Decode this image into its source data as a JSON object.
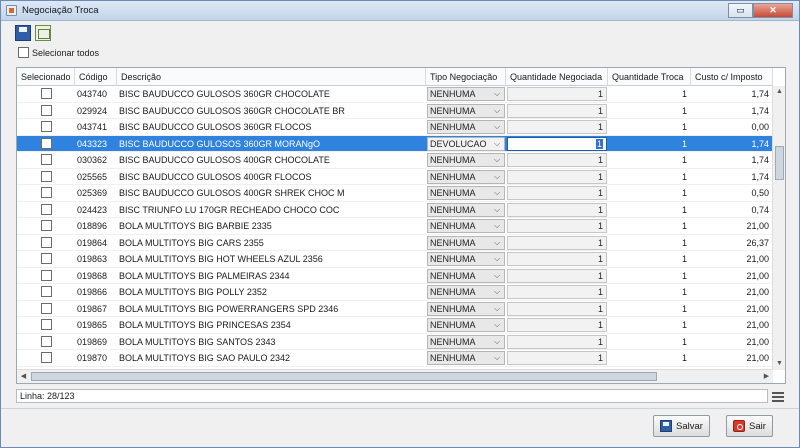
{
  "window": {
    "title": "Negociação Troca"
  },
  "window_buttons": {
    "restore": "▭",
    "close": "✕"
  },
  "select_all": {
    "label": "Selecionar todos"
  },
  "table": {
    "columns": [
      "Selecionado",
      "Código",
      "Descrição",
      "Tipo Negociação",
      "Quantidade Negociada",
      "Quantidade Troca",
      "Custo c/ Imposto"
    ],
    "rows": [
      {
        "code": "043740",
        "desc": "BISC BAUDUCCO GULOSOS 360GR CHOCOLATE",
        "tipo": "NENHUMA",
        "qtd_neg": "1",
        "qtd_troca": "1",
        "custo": "1,74"
      },
      {
        "code": "029924",
        "desc": "BISC BAUDUCCO GULOSOS 360GR CHOCOLATE BR",
        "tipo": "NENHUMA",
        "qtd_neg": "1",
        "qtd_troca": "1",
        "custo": "1,74"
      },
      {
        "code": "043741",
        "desc": "BISC BAUDUCCO GULOSOS 360GR FLOCOS",
        "tipo": "NENHUMA",
        "qtd_neg": "1",
        "qtd_troca": "1",
        "custo": "0,00"
      },
      {
        "code": "043323",
        "desc": "BISC BAUDUCCO GULOSOS 360GR MORANgO",
        "tipo": "DEVOLUCAO",
        "qtd_neg": "1",
        "qtd_troca": "1",
        "custo": "1,74",
        "selected": true
      },
      {
        "code": "030362",
        "desc": "BISC BAUDUCCO GULOSOS 400GR CHOCOLATE",
        "tipo": "NENHUMA",
        "qtd_neg": "1",
        "qtd_troca": "1",
        "custo": "1,74"
      },
      {
        "code": "025565",
        "desc": "BISC BAUDUCCO GULOSOS 400GR FLOCOS",
        "tipo": "NENHUMA",
        "qtd_neg": "1",
        "qtd_troca": "1",
        "custo": "1,74"
      },
      {
        "code": "025369",
        "desc": "BISC BAUDUCCO GULOSOS 400GR SHREK CHOC M",
        "tipo": "NENHUMA",
        "qtd_neg": "1",
        "qtd_troca": "1",
        "custo": "0,50"
      },
      {
        "code": "024423",
        "desc": "BISC TRIUNFO LU 170GR RECHEADO CHOCO COC",
        "tipo": "NENHUMA",
        "qtd_neg": "1",
        "qtd_troca": "1",
        "custo": "0,74"
      },
      {
        "code": "018896",
        "desc": "BOLA MULTITOYS BIG BARBIE 2335",
        "tipo": "NENHUMA",
        "qtd_neg": "1",
        "qtd_troca": "1",
        "custo": "21,00"
      },
      {
        "code": "019864",
        "desc": "BOLA MULTITOYS BIG CARS 2355",
        "tipo": "NENHUMA",
        "qtd_neg": "1",
        "qtd_troca": "1",
        "custo": "26,37"
      },
      {
        "code": "019863",
        "desc": "BOLA MULTITOYS BIG HOT WHEELS AZUL 2356",
        "tipo": "NENHUMA",
        "qtd_neg": "1",
        "qtd_troca": "1",
        "custo": "21,00"
      },
      {
        "code": "019868",
        "desc": "BOLA MULTITOYS BIG PALMEIRAS 2344",
        "tipo": "NENHUMA",
        "qtd_neg": "1",
        "qtd_troca": "1",
        "custo": "21,00"
      },
      {
        "code": "019866",
        "desc": "BOLA MULTITOYS BIG POLLY 2352",
        "tipo": "NENHUMA",
        "qtd_neg": "1",
        "qtd_troca": "1",
        "custo": "21,00"
      },
      {
        "code": "019867",
        "desc": "BOLA MULTITOYS BIG POWERRANGERS SPD 2346",
        "tipo": "NENHUMA",
        "qtd_neg": "1",
        "qtd_troca": "1",
        "custo": "21,00"
      },
      {
        "code": "019865",
        "desc": "BOLA MULTITOYS BIG PRINCESAS 2354",
        "tipo": "NENHUMA",
        "qtd_neg": "1",
        "qtd_troca": "1",
        "custo": "21,00"
      },
      {
        "code": "019869",
        "desc": "BOLA MULTITOYS BIG SANTOS 2343",
        "tipo": "NENHUMA",
        "qtd_neg": "1",
        "qtd_troca": "1",
        "custo": "21,00"
      },
      {
        "code": "019870",
        "desc": "BOLA MULTITOYS BIG SAO PAULO 2342",
        "tipo": "NENHUMA",
        "qtd_neg": "1",
        "qtd_troca": "1",
        "custo": "21,00"
      }
    ]
  },
  "status": {
    "text": "Linha: 28/123"
  },
  "buttons": {
    "save": "Salvar",
    "exit": "Sair"
  },
  "icons": {
    "save": "save-icon",
    "grid": "grid-config-icon",
    "menu": "menu-icon",
    "combo_arrow": "chevron-down-icon"
  },
  "colors": {
    "selection": "#2f82dd",
    "title_bar": "#c2d4ea"
  }
}
